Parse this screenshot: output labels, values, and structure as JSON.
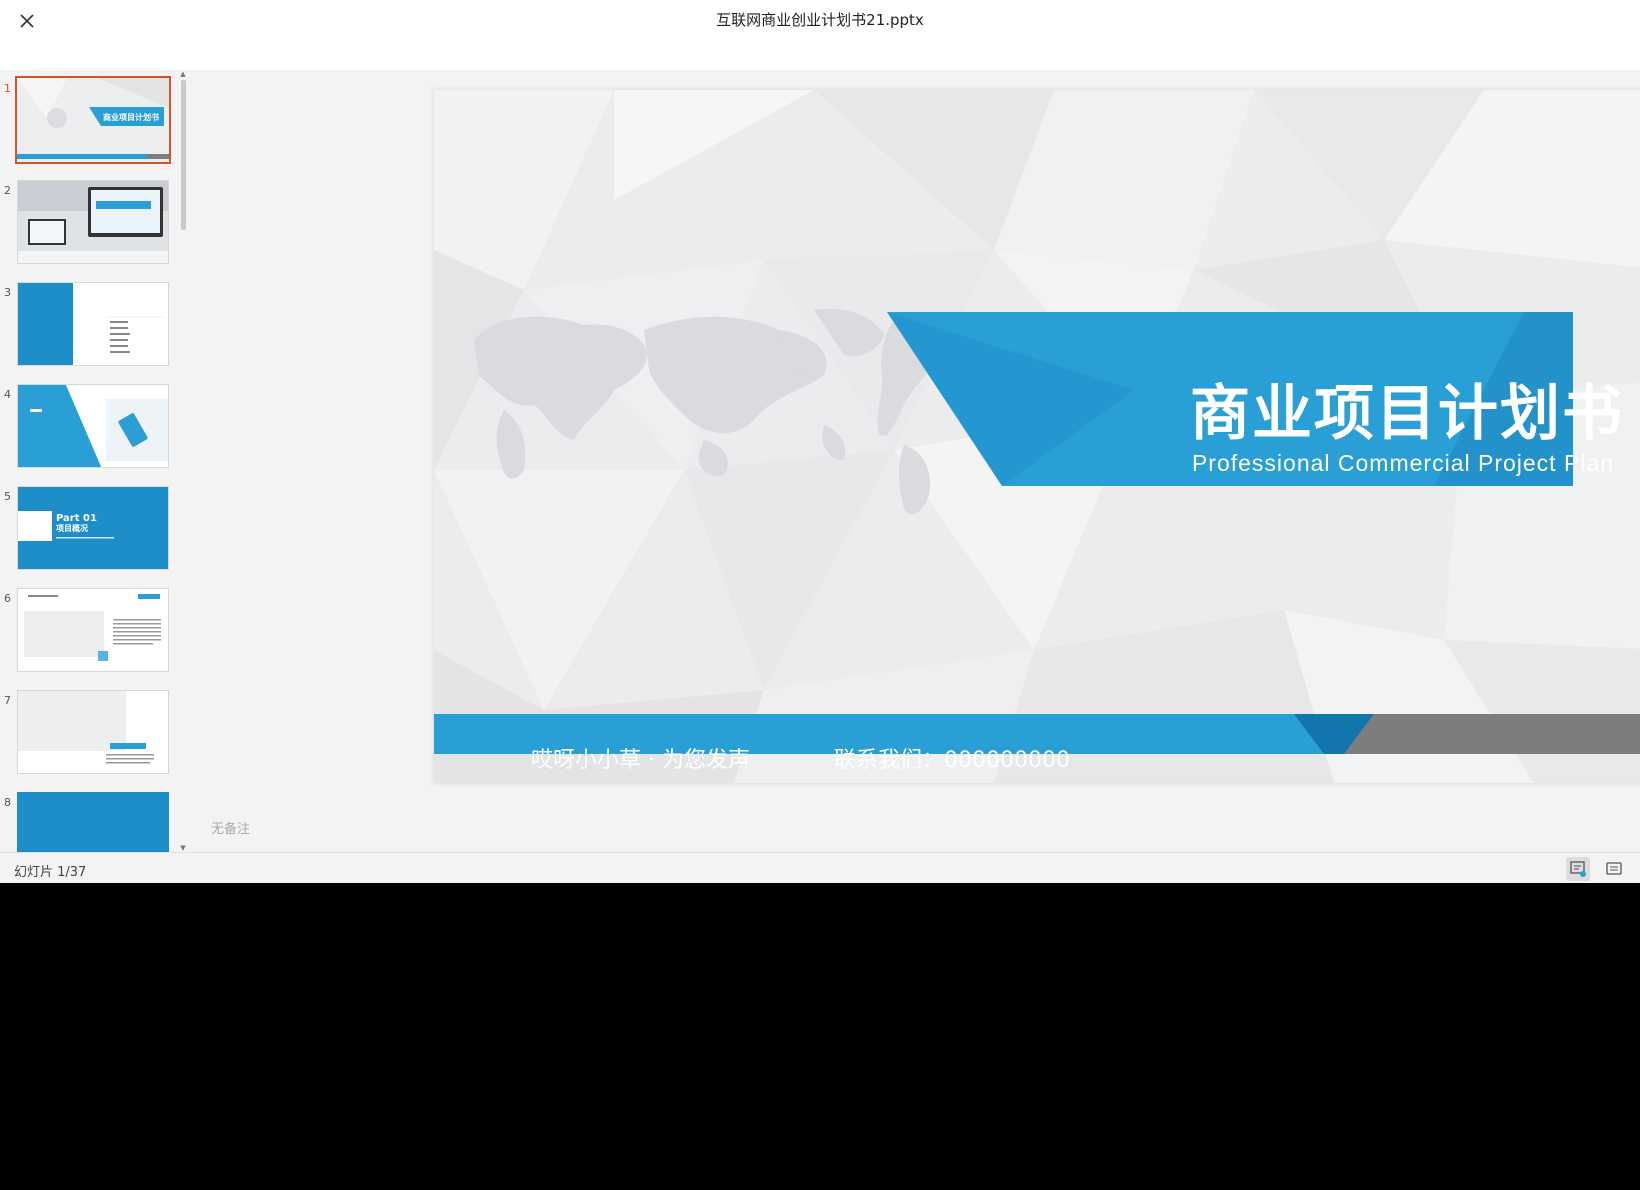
{
  "window": {
    "title": "互联网商业创业计划书21.pptx"
  },
  "thumbnails": [
    {
      "num": "1",
      "label": "商业项目计划书"
    },
    {
      "num": "2",
      "label": ""
    },
    {
      "num": "3",
      "label": ""
    },
    {
      "num": "4",
      "label": ""
    },
    {
      "num": "5",
      "label": "Part 01"
    },
    {
      "num": "6",
      "label": ""
    },
    {
      "num": "7",
      "label": ""
    },
    {
      "num": "8",
      "label": ""
    }
  ],
  "thumbnail_texts": {
    "t5_line1": "Part 01",
    "t5_line2": "项目概况"
  },
  "slide": {
    "title": "商业项目计划书",
    "subtitle": "Professional Commercial Project Plan",
    "footer_left": "哎呀小小草 · 为您发声",
    "footer_right": "联系我们：000000000"
  },
  "notes": {
    "placeholder": "无备注"
  },
  "status": {
    "slide_counter": "幻灯片 1/37"
  },
  "colors": {
    "accent": "#2a9fd6",
    "accent_dark": "#1584be",
    "active_border": "#d0562a",
    "footer_gray": "#7d7d7d"
  }
}
